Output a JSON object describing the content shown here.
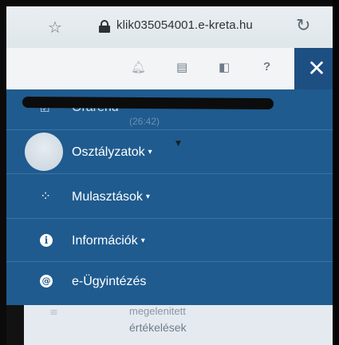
{
  "browser": {
    "url": "klik035054001.e-kreta.hu",
    "star_icon": "star-icon",
    "lock_icon": "lock-icon",
    "reload_icon": "reload-icon"
  },
  "toolbar": {
    "icons": [
      "bell-icon",
      "grid-icon",
      "book-icon",
      "help-icon"
    ],
    "help_label": "?",
    "close_label": "✕"
  },
  "menu": {
    "items": [
      {
        "label": "Órarend",
        "icon": "calendar-check-icon"
      },
      {
        "label": "Osztályzatok",
        "icon": "avatar"
      },
      {
        "label": "Mulasztások",
        "icon": "spinner-icon"
      },
      {
        "label": "Információk",
        "icon": "info-icon"
      },
      {
        "label": "e-Ügyintézés",
        "icon": "at-icon"
      }
    ],
    "ghost_time": "(26:42)"
  },
  "underlying": {
    "line1": "megelenitett",
    "line2": "értékelések"
  },
  "colors": {
    "menu_bg": "#1f5b8f",
    "close_bg": "#1e4f82",
    "toolbar_bg": "#f2f4f6"
  }
}
